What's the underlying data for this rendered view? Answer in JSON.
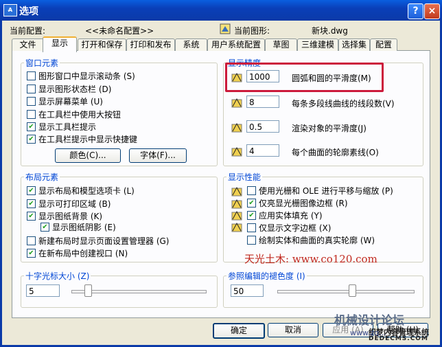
{
  "window": {
    "title": "选项",
    "icon_text": "A̶",
    "help_label": "?",
    "close_label": "×"
  },
  "header": {
    "profile_label": "当前配置:",
    "profile_value": "<<未命名配置>>",
    "drawing_label": "当前图形:",
    "drawing_value": "新块.dwg"
  },
  "tabs": [
    "文件",
    "显示",
    "打开和保存",
    "打印和发布",
    "系统",
    "用户系统配置",
    "草图",
    "三维建模",
    "选择集",
    "配置"
  ],
  "active_tab": "显示",
  "window_elements": {
    "title": "窗口元素",
    "options": [
      {
        "label": "图形窗口中显示滚动条 (S)",
        "checked": false
      },
      {
        "label": "显示图形状态栏 (D)",
        "checked": false
      },
      {
        "label": "显示屏幕菜单 (U)",
        "checked": false
      },
      {
        "label": "在工具栏中使用大按钮",
        "checked": false
      },
      {
        "label": "显示工具栏提示",
        "checked": true
      },
      {
        "label": "在工具栏提示中显示快捷键",
        "checked": true
      }
    ],
    "colors_button": "颜色(C)...",
    "fonts_button": "字体(F)..."
  },
  "display_resolution": {
    "title": "显示精度",
    "rows": [
      {
        "value": "1000",
        "label": "圆弧和圆的平滑度(M)"
      },
      {
        "value": "8",
        "label": "每条多段线曲线的线段数(V)"
      },
      {
        "value": "0.5",
        "label": "渲染对象的平滑度(J)"
      },
      {
        "value": "4",
        "label": "每个曲面的轮廓素线(O)"
      }
    ],
    "highlight_color": "#cc1a3b"
  },
  "layout_elements": {
    "title": "布局元素",
    "options": [
      {
        "label": "显示布局和模型选项卡 (L)",
        "checked": true
      },
      {
        "label": "显示可打印区域 (B)",
        "checked": true
      },
      {
        "label": "显示图纸背景 (K)",
        "checked": true
      },
      {
        "label": "显示图纸阴影 (E)",
        "checked": true
      },
      {
        "label": "新建布局时显示页面设置管理器 (G)",
        "checked": false
      },
      {
        "label": "在新布局中创建视口 (N)",
        "checked": true
      }
    ]
  },
  "display_performance": {
    "title": "显示性能",
    "options": [
      {
        "label": "使用光栅和 OLE 进行平移与缩放 (P)",
        "checked": false
      },
      {
        "label": "仅亮显光栅图像边框 (R)",
        "checked": true
      },
      {
        "label": "应用实体填充 (Y)",
        "checked": true
      },
      {
        "label": "仅显示文字边框 (X)",
        "checked": false
      },
      {
        "label": "绘制实体和曲面的真实轮廓 (W)",
        "checked": false
      }
    ],
    "watermark": "天光土木: www.co120.com"
  },
  "crosshair": {
    "title": "十字光标大小 (Z)",
    "value": "5",
    "level_percent": 5
  },
  "xref_fade": {
    "title": "参照编辑的褪色度 (I)",
    "value": "50",
    "level_percent": 50
  },
  "footer": {
    "ok": "确定",
    "cancel": "取消",
    "apply": "应用 (A)",
    "help": "帮助 (H)"
  },
  "watermark2": {
    "line1": "机械设计论坛",
    "line2": "织梦内容管理系统",
    "line3": "www.zg...",
    "line4": "DEDECMS.COM"
  }
}
